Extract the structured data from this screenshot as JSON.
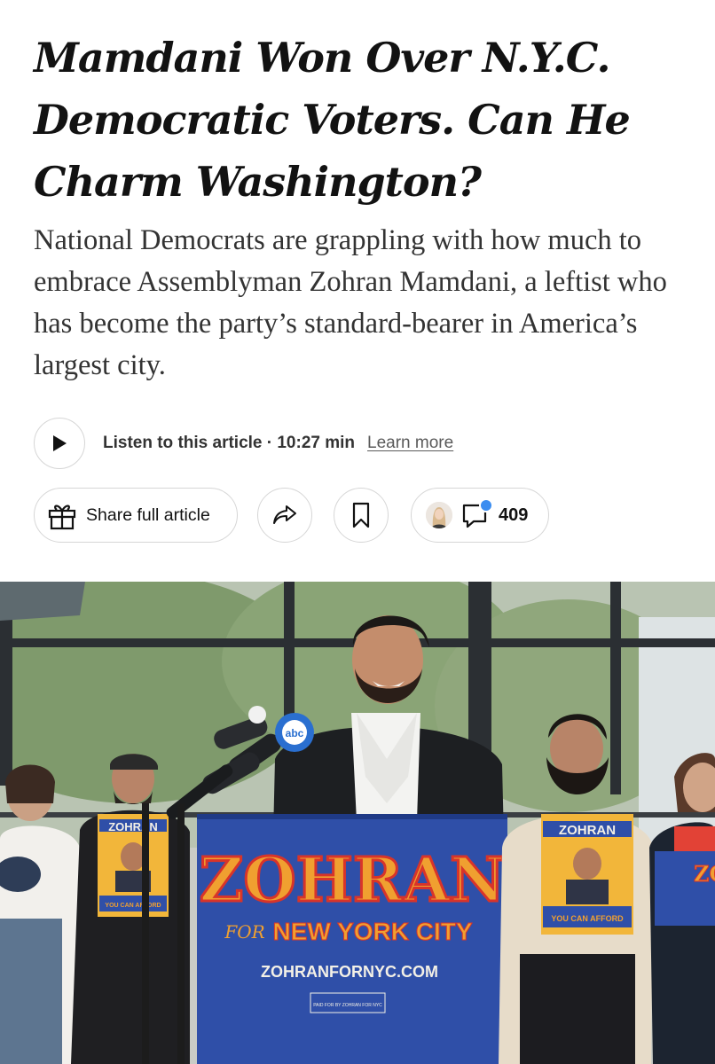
{
  "article": {
    "headline": "Mamdani Won Over N.Y.C. Democratic Voters. Can He Charm Washington?",
    "summary": "National Democrats are grappling with how much to embrace Assemblyman Zohran Mamdani, a leftist who has become the party’s standard-bearer in America’s largest city."
  },
  "audio": {
    "listen_label": "Listen to this article · 10:27 min",
    "learn_more": "Learn more"
  },
  "actions": {
    "share_full_label": "Share full article",
    "comment_count": "409"
  },
  "photo": {
    "sign_name": "ZOHRAN",
    "sign_for": "FOR",
    "sign_city": "NEW YORK CITY",
    "sign_url": "ZOHRANFORNYC.COM",
    "sign_fine_print": "PAID FOR BY ZOHRAN FOR NYC",
    "poster_name": "ZOHRAN",
    "poster_tagline": "YOU CAN AFFORD",
    "mic_logo": "abc"
  },
  "colors": {
    "sign_blue": "#2f4fa8",
    "sign_orange": "#f0a030",
    "sign_red": "#d8342a",
    "notification": "#3b8df0"
  }
}
